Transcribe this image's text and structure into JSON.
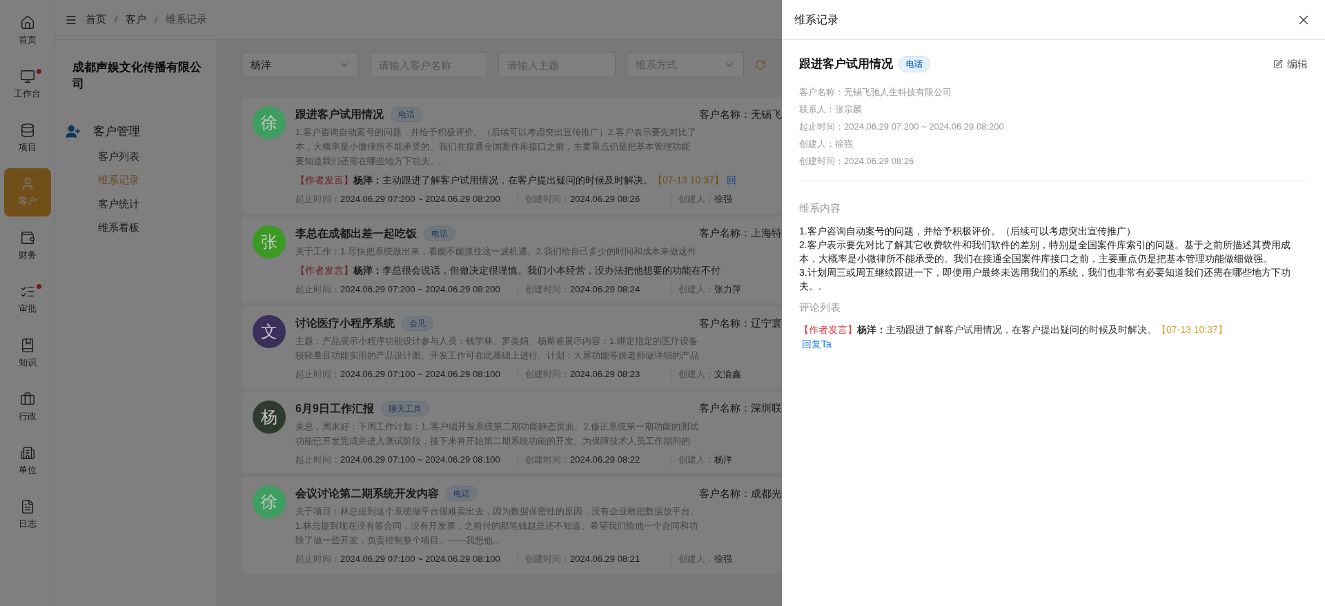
{
  "rail": [
    {
      "label": "首页",
      "selected": false,
      "badge": false
    },
    {
      "label": "工作台",
      "selected": false,
      "badge": true
    },
    {
      "label": "项目",
      "selected": false,
      "badge": false
    },
    {
      "label": "客户",
      "selected": true,
      "badge": false
    },
    {
      "label": "财务",
      "selected": false,
      "badge": false
    },
    {
      "label": "审批",
      "selected": false,
      "badge": true
    },
    {
      "label": "知识",
      "selected": false,
      "badge": false
    },
    {
      "label": "行政",
      "selected": false,
      "badge": false
    },
    {
      "label": "单位",
      "selected": false,
      "badge": false
    },
    {
      "label": "日志",
      "selected": false,
      "badge": false
    }
  ],
  "breadcrumb": [
    {
      "kind": "link",
      "text": "首页"
    },
    {
      "kind": "separator",
      "text": "/"
    },
    {
      "kind": "link",
      "text": "客户"
    },
    {
      "kind": "separator",
      "text": "/"
    },
    {
      "kind": "current",
      "text": "维系记录"
    }
  ],
  "company": "成都声娱文化传播有限公司",
  "menu": {
    "title": "客户管理",
    "items": [
      {
        "label": "客户列表",
        "selected": false
      },
      {
        "label": "维系记录",
        "selected": true
      },
      {
        "label": "客户统计",
        "selected": false
      },
      {
        "label": "维系看板",
        "selected": false
      }
    ]
  },
  "filters": {
    "owner": "杨洋",
    "customer_placeholder": "请输入客户名称",
    "topic_placeholder": "请输入主题",
    "method_placeholder": "维系方式"
  },
  "records": [
    {
      "avatar": "徐",
      "color": "#3d9e5f",
      "title": "跟进客户试用情况",
      "tag": "电话",
      "customer": "客户名称：无锡飞",
      "lines": [
        "1.客户咨询自动案号的问题，并给予积极评价。（后续可以考虑突出宣传推广）2.客户表示要先对比了",
        "本，大概率是小微律所不能承受的。我们在接通全国案件库接口之前，主要重点仍是把基本管理功能",
        "要知道我们还需在哪些地方下功夫。."
      ],
      "comment": {
        "tag": "【作者发言】",
        "author": "杨洋：",
        "text": "主动跟进了解客户试用情况，在客户提出疑问的时候及时解决。",
        "time": "【07-13 10:37】",
        "reply": "回"
      },
      "meta": [
        {
          "label": "起止时间：",
          "value": "2024.06.29 07:200 ~ 2024.06.29 08:200"
        },
        {
          "label": "创建时间：",
          "value": "2024.06.29 08:26"
        },
        {
          "label": "创建人：",
          "value": "徐强"
        }
      ]
    },
    {
      "avatar": "张",
      "color": "#3a9a22",
      "title": "李总在成都出差一起吃饭",
      "tag": "电话",
      "customer": "客户名称：上海特",
      "lines": [
        "关于工作：1.尽快把系统做出来，看能不能抓住这一波机遇。2.我们给自己多少的时间和成本来做这件"
      ],
      "comment": {
        "tag": "【作者发言】",
        "author": "杨洋：",
        "text": "李总很会说话，但做决定很谨慎。我们小本经营，没办法把他想要的功能在不付"
      },
      "meta": [
        {
          "label": "起止时间：",
          "value": "2024.06.29 07:200 ~ 2024.06.29 08:200"
        },
        {
          "label": "创建时间：",
          "value": "2024.06.29 08:24"
        },
        {
          "label": "创建人：",
          "value": "张力萍"
        }
      ]
    },
    {
      "avatar": "文",
      "color": "#3b2f5c",
      "title": "讨论医疗小程序系统",
      "tag": "会见",
      "customer": "客户名称：辽宁寰",
      "lines": [
        "主题：产品展示小程序功能设计参与人员：钱学林、罗美娟、杨斯睿展示内容：1.绑定指定的医疗设备",
        "较轻量且功能实用的产品设计图。开发工作可在此基础上进行。计划：大屏功能等姬老师做详细的产品"
      ],
      "meta": [
        {
          "label": "起止时间：",
          "value": "2024.06.29 07:100 ~ 2024.06.29 08:100"
        },
        {
          "label": "创建时间：",
          "value": "2024.06.29 08:23"
        },
        {
          "label": "创建人：",
          "value": "文渝鑫"
        }
      ]
    },
    {
      "avatar": "杨",
      "color": "#2f3a2f",
      "title": "6月9日工作汇报",
      "tag": "聊天工具",
      "customer": "客户名称：深圳联",
      "lines": [
        "吴总，周末好：下周工作计划：1..客户端开发系统第二期功能静态页面。2.修正系统第一期功能的测试",
        "功能已开发完成并进入测试阶段，接下来将开始第二期系统功能的开发。为保障技术人员工作期间的"
      ],
      "meta": [
        {
          "label": "起止时间：",
          "value": "2024.06.29 07:100 ~ 2024.06.29 08:100"
        },
        {
          "label": "创建时间：",
          "value": "2024.06.29 08:22"
        },
        {
          "label": "创建人：",
          "value": "杨洋"
        }
      ]
    },
    {
      "avatar": "徐",
      "color": "#3d9e5f",
      "title": "会议讨论第二期系统开发内容",
      "tag": "电话",
      "customer": "客户名称：成都光",
      "lines": [
        "关于项目：林总提到这个系统做平台很难卖出去，因为数据保密性的原因，没有企业敢把数据放平台。",
        "1.林总提到现在没有签合同，没有开发票，之前付的那笔钱赵总还不知道。希望我们给他一个合同和功",
        "除了做一些开发，负责控制整个项目。——我想他..."
      ],
      "meta": [
        {
          "label": "起止时间：",
          "value": "2024.06.29 07:100 ~ 2024.06.29 08:100"
        },
        {
          "label": "创建时间：",
          "value": "2024.06.29 08:21"
        },
        {
          "label": "创建人：",
          "value": "徐强"
        }
      ]
    }
  ],
  "drawer": {
    "title": "维系记录",
    "record_title": "跟进客户试用情况",
    "tag": "电话",
    "edit": "编辑",
    "info": [
      "客户名称：无锡飞驰人生科技有限公司",
      "联系人：张宗麟",
      "起止时间：2024.06.29 07:200 ~ 2024.06.29 08:200",
      "创建人：徐强",
      "创建时间：2024.06.29 08:26"
    ],
    "content_heading": "维系内容",
    "content": [
      "1.客户咨询自动案号的问题，并给予积极评价。（后续可以考虑突出宣传推广）",
      "2.客户表示要先对比了解其它收费软件和我们软件的差别，特别是全国案件库索引的问题。基于之前所描述其费用成本，大概率是小微律所不能承受的。我们在接通全国案件库接口之前，主要重点仍是把基本管理功能做细做强。",
      "3.计划周三或周五继续跟进一下，即便用户最终未选用我们的系统，我们也非常有必要知道我们还需在哪些地方下功夫。."
    ],
    "comments_heading": "评论列表",
    "comment": {
      "tag": "【作者发言】",
      "author": "杨洋：",
      "text": "主动跟进了解客户试用情况，在客户提出疑问的时候及时解决。",
      "time": "【07-13 10:37】",
      "reply": "回复Ta"
    }
  }
}
